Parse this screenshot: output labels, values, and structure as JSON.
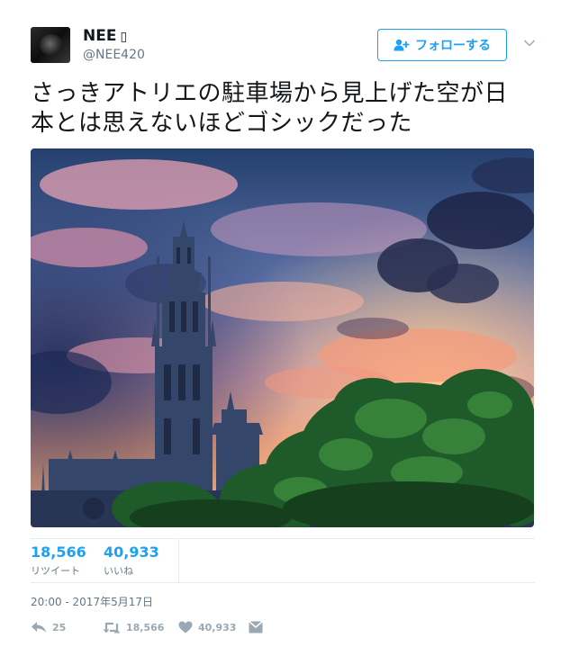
{
  "user": {
    "display_name": "NEE",
    "name_glyph": "▯",
    "handle": "@NEE420"
  },
  "follow_button": {
    "label": "フォローする"
  },
  "tweet": {
    "text_line1": "さっきアトリエの駐車場から見上げた空が日",
    "text_line2": "本とは思えないほどゴシックだった",
    "timestamp": "20:00 - 2017年5月17日"
  },
  "stats": {
    "retweets": {
      "count": "18,566",
      "label": "リツイート"
    },
    "likes": {
      "count": "40,933",
      "label": "いいね"
    }
  },
  "actions": {
    "reply_count": "25",
    "retweet_count": "18,566",
    "like_count": "40,933"
  },
  "colors": {
    "accent": "#1da1f2",
    "muted": "#657786",
    "action_gray": "#9aa8b3"
  },
  "icons": [
    "follow-user-icon",
    "chevron-down-icon",
    "reply-icon",
    "retweet-icon",
    "heart-icon",
    "direct-message-icon"
  ]
}
